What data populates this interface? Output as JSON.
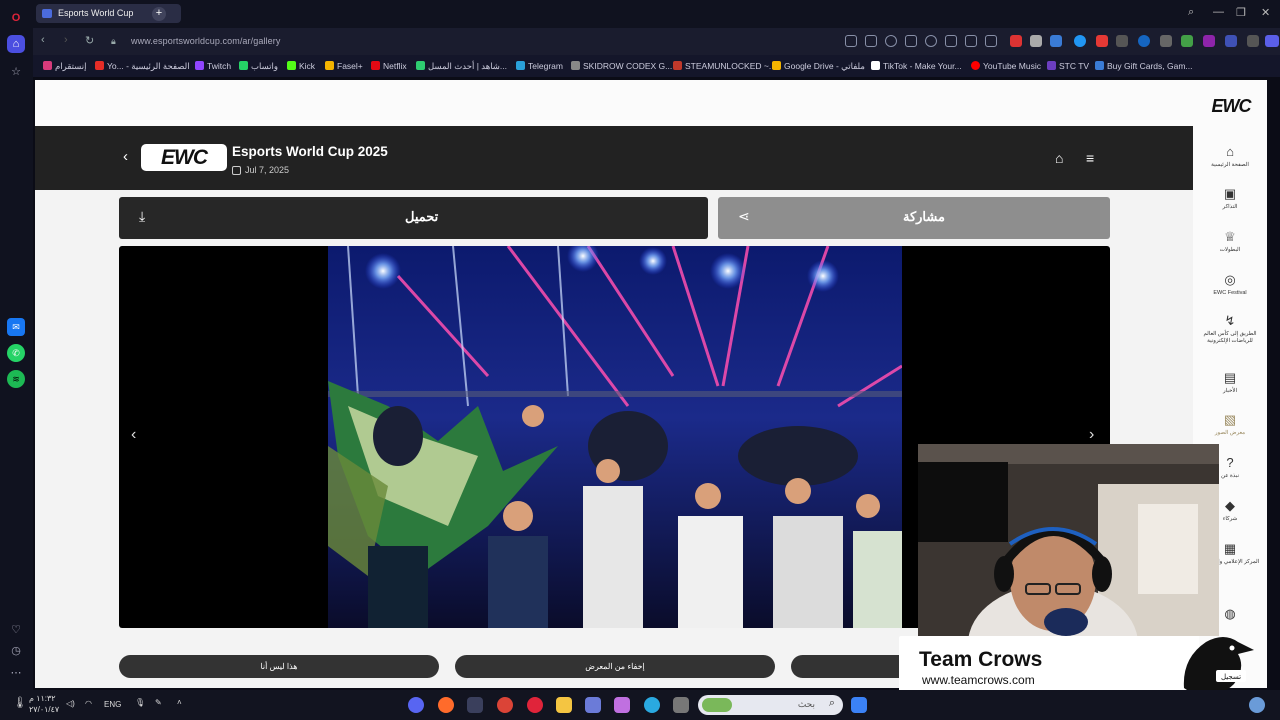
{
  "browser": {
    "tab_title": "Esports World Cup",
    "url": "www.esportsworldcup.com/ar/gallery",
    "bookmarks": [
      {
        "label": "إنستقرام",
        "color": "#d83b7c"
      },
      {
        "label": "Yo... - الصفحة الرئيسية",
        "color": "#e52d27"
      },
      {
        "label": "Twitch",
        "color": "#9146ff"
      },
      {
        "label": "واتساب",
        "color": "#25d366"
      },
      {
        "label": "Kick",
        "color": "#53fc18"
      },
      {
        "label": "Fasel+",
        "color": "#f4b400"
      },
      {
        "label": "Netflix",
        "color": "#e50914"
      },
      {
        "label": "شاهد | أحدث المسل...",
        "color": "#2ecc71"
      },
      {
        "label": "Telegram",
        "color": "#2aa1da"
      },
      {
        "label": "SKIDROW CODEX G...",
        "color": "#888888"
      },
      {
        "label": "STEAMUNLOCKED ~...",
        "color": "#c0392b"
      },
      {
        "label": "Google Drive - ملفاتي",
        "color": "#f4b400"
      },
      {
        "label": "TikTok - Make Your...",
        "color": "#ffffff"
      },
      {
        "label": "YouTube Music",
        "color": "#ff0000"
      },
      {
        "label": "STC TV",
        "color": "#6c3ec1"
      },
      {
        "label": "Buy Gift Cards, Gam...",
        "color": "#3a7bd5"
      }
    ]
  },
  "header": {
    "logo_text": "EWC",
    "title": "Esports World Cup 2025",
    "date": "Jul 7, 2025"
  },
  "actions": {
    "download_label": "تحميل",
    "share_label": "مشاركة"
  },
  "bottom_buttons": [
    "هذا ليس أنا",
    "إخفاء من المعرض"
  ],
  "side_nav": {
    "logo_text": "EWC",
    "items": [
      {
        "label": "الصفحة الرئيسية",
        "icon": "home-icon"
      },
      {
        "label": "التذاكر",
        "icon": "ticket-icon"
      },
      {
        "label": "البطولات",
        "icon": "trophy-icon"
      },
      {
        "label": "EWC Festival",
        "icon": "gamepad-icon"
      },
      {
        "label": "الطريق إلى كأس العالم للرياضات الإلكترونية",
        "icon": "route-icon"
      },
      {
        "label": "الأخبار",
        "icon": "news-icon"
      },
      {
        "label": "معرض الصور",
        "icon": "gallery-icon"
      },
      {
        "label": "نبذة عن",
        "icon": "question-icon"
      },
      {
        "label": "شركاء",
        "icon": "handshake-icon"
      },
      {
        "label": "المركز الإعلامي والصحفي",
        "icon": "media-icon"
      },
      {
        "label": "",
        "icon": "globe-icon"
      }
    ]
  },
  "overlay": {
    "brand_name": "Team Crows",
    "brand_url": "www.teamcrows.com",
    "badge": "تسجيل"
  },
  "taskbar": {
    "time": "١١:٣٢ م",
    "date": "٢٧/٠١/٤٧",
    "language": "ENG",
    "search_placeholder": "بحث"
  }
}
